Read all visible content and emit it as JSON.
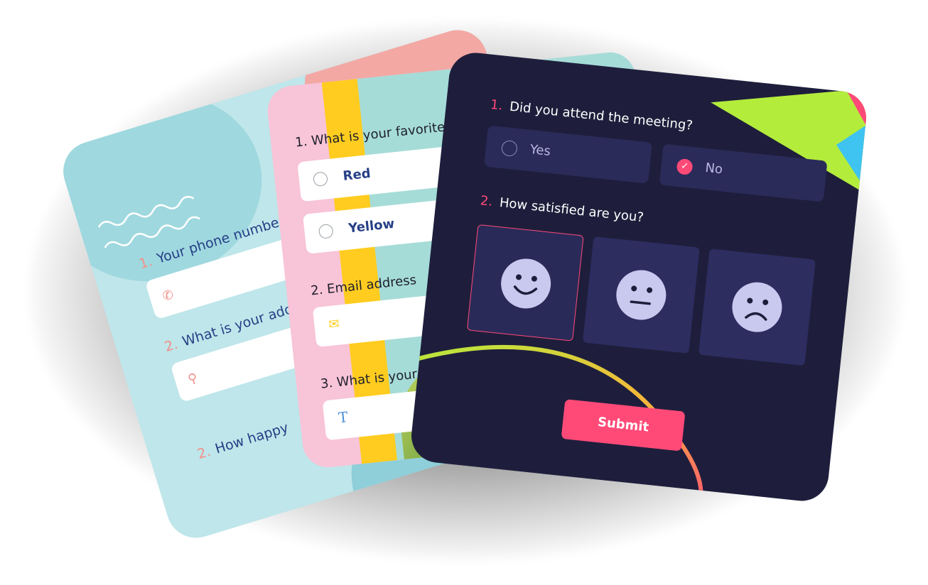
{
  "card_a": {
    "questions": [
      {
        "num": "1.",
        "text": "Your phone number"
      },
      {
        "num": "2.",
        "text": "What is your address"
      },
      {
        "num": "2.",
        "text": "How happy"
      }
    ]
  },
  "card_b": {
    "questions": [
      {
        "num": "1.",
        "text": "What is your favorite col"
      },
      {
        "num": "2.",
        "text": "Email address"
      },
      {
        "num": "3.",
        "text": "What is your"
      }
    ],
    "options": [
      "Red",
      "Yellow"
    ],
    "text_icon": "T"
  },
  "card_c": {
    "q1": {
      "num": "1.",
      "text": "Did you attend the meeting?"
    },
    "q1_options": [
      {
        "label": "Yes",
        "selected": false
      },
      {
        "label": "No",
        "selected": true
      }
    ],
    "q2": {
      "num": "2.",
      "text": "How satisfied are you?"
    },
    "faces": [
      "happy-face-icon",
      "neutral-face-icon",
      "sad-face-icon"
    ],
    "submit": "Submit"
  },
  "colors": {
    "accent": "#ff4a78",
    "dark_bg": "#1e1e3c",
    "navy_text": "#263f86"
  }
}
